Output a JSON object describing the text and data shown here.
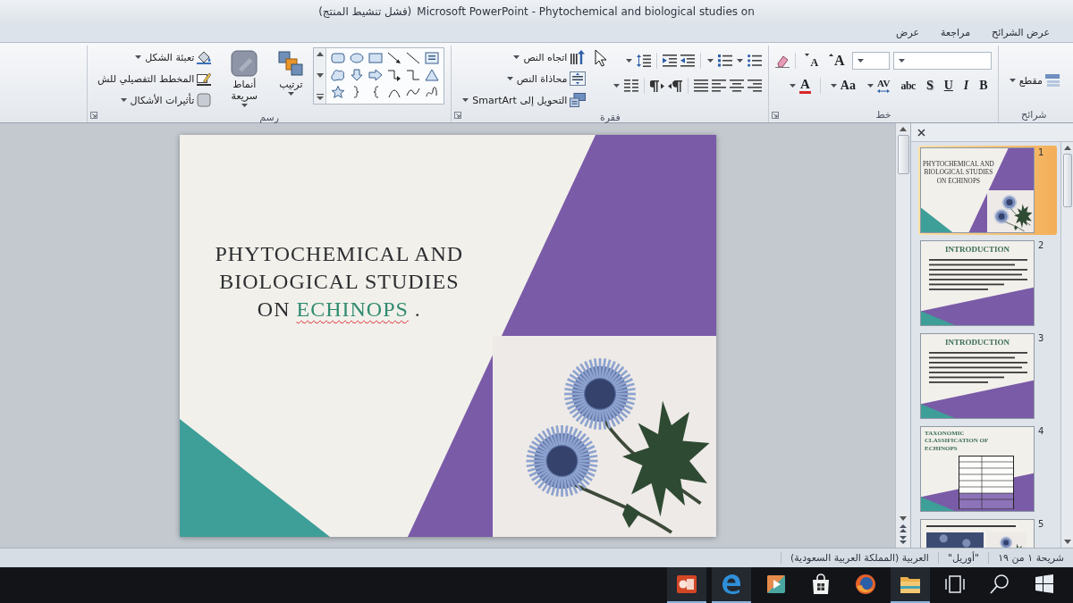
{
  "window": {
    "activation_notice": "(فشل تنشيط المنتج)",
    "title": "Microsoft PowerPoint - Phytochemical and biological studies on"
  },
  "tabs": [
    {
      "label": "عرض الشرائح"
    },
    {
      "label": "مراجعة"
    },
    {
      "label": "عرض"
    }
  ],
  "ribbon": {
    "groups": [
      {
        "kind": "slides",
        "label": "شرائح",
        "commands": [
          {
            "label": "مقطع",
            "dropdown": true
          }
        ]
      },
      {
        "kind": "font",
        "label": "خط",
        "size_buttons": [
          {
            "kind": "grow",
            "text": "A"
          },
          {
            "kind": "shrink",
            "text": "A"
          }
        ],
        "format_buttons": [
          {
            "kind": "bold",
            "text": "B",
            "dropdown": false
          },
          {
            "kind": "italic",
            "text": "I",
            "dropdown": false
          },
          {
            "kind": "underline",
            "text": "U",
            "dropdown": false
          },
          {
            "kind": "shadow",
            "text": "S",
            "dropdown": false
          },
          {
            "kind": "strike",
            "text": "abc",
            "dropdown": false
          },
          {
            "kind": "spacing",
            "text": "AV",
            "dropdown": true
          },
          {
            "kind": "case",
            "text": "Aa",
            "dropdown": true
          },
          {
            "kind": "color",
            "text": "A",
            "dropdown": true
          }
        ]
      },
      {
        "kind": "paragraph",
        "label": "فقرة",
        "commands": [
          {
            "kind": "direction",
            "label": "اتجاه النص",
            "dropdown": true
          },
          {
            "kind": "align",
            "label": "محاذاة النص",
            "dropdown": true
          },
          {
            "kind": "smartart",
            "label": "التحويل إلى SmartArt",
            "dropdown": true
          }
        ]
      },
      {
        "kind": "drawing",
        "label": "رسم",
        "arrange": {
          "label": "ترتيب",
          "dropdown": true
        },
        "quick_styles": {
          "label": "أنماط سريعة",
          "dropdown": true
        },
        "commands": [
          {
            "kind": "fill",
            "label": "تعبئة الشكل",
            "dropdown": true
          },
          {
            "kind": "outline",
            "label": "المخطط التفصيلي للش",
            "dropdown": false
          },
          {
            "kind": "effects",
            "label": "تأثيرات الأشكال",
            "dropdown": true
          }
        ]
      }
    ]
  },
  "slide": {
    "title_lines": [
      "PHYTOCHEMICAL AND",
      "BIOLOGICAL STUDIES"
    ],
    "last_line": {
      "before": "ON",
      "word": {
        "text": "ECHINOPS",
        "color": "#2e8b6f",
        "misspelled": true
      },
      "after": "."
    }
  },
  "thumbnails": {
    "slides": [
      {
        "number": "1",
        "selected": true,
        "kind": "title",
        "title_lines": [
          "PHYTOCHEMICAL AND",
          "BIOLOGICAL STUDIES",
          "ON ECHINOPS"
        ]
      },
      {
        "number": "2",
        "selected": false,
        "kind": "text",
        "title": "INTRODUCTION"
      },
      {
        "number": "3",
        "selected": false,
        "kind": "text",
        "title": "INTRODUCTION"
      },
      {
        "number": "4",
        "selected": false,
        "kind": "table",
        "title": "TAXONOMIC CLASSIFICATION OF ECHINOPS"
      },
      {
        "number": "5",
        "selected": false,
        "kind": "image"
      }
    ]
  },
  "status_bar": {
    "slide": "شريحة ١ من ١٩",
    "theme": "\"أوريل\"",
    "language": "العربية (المملكة العربية السعودية)"
  },
  "taskbar": {
    "apps": [
      {
        "kind": "start",
        "running": false
      },
      {
        "kind": "search",
        "running": false
      },
      {
        "kind": "task-view",
        "running": false
      },
      {
        "kind": "explorer",
        "running": true
      },
      {
        "kind": "firefox",
        "running": false
      },
      {
        "kind": "store",
        "running": false
      },
      {
        "kind": "media",
        "running": false
      },
      {
        "kind": "edge",
        "running": true
      },
      {
        "kind": "powerpoint",
        "running": true
      }
    ]
  }
}
